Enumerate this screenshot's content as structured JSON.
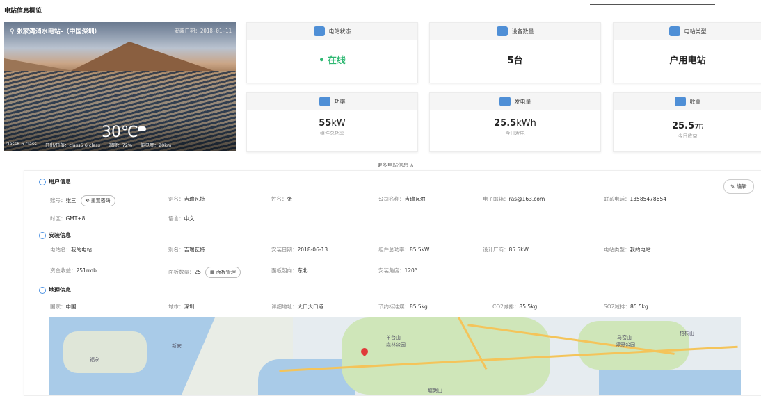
{
  "page": {
    "title": "电站信息概览"
  },
  "hero": {
    "name": "张家湾消水电站-（中国深圳）",
    "install_date": "安装日期：2018-01-11",
    "temperature": "30℃",
    "bottom_items": [
      "class8 6 class",
      "日出/日落：class5 6 class",
      "湿度：72%",
      "能见度：20km"
    ]
  },
  "cards": [
    {
      "title": "电站状态",
      "value": "在线",
      "status_dot": "•"
    },
    {
      "title": "设备数量",
      "value": "5台"
    },
    {
      "title": "电站类型",
      "value": "户用电站"
    },
    {
      "title": "功率",
      "value_num": "55",
      "value_unit": "kW",
      "sub": "组件总功率",
      "dash": "—— —"
    },
    {
      "title": "发电量",
      "value_num": "25.5",
      "value_unit": "kWh",
      "sub": "今日发电",
      "dash": "—— —"
    },
    {
      "title": "收益",
      "value_num": "25.5",
      "value_unit": "元",
      "sub": "今日收益",
      "dash": "—— —"
    }
  ],
  "more_link": "更多电站信息 ∧",
  "edit_label": "编辑",
  "user": {
    "title": "用户信息",
    "account": {
      "k": "账号：",
      "v": "张三"
    },
    "reset_password": "重置密码",
    "alias": {
      "k": "别名：",
      "v": "吉瑞瓦特"
    },
    "name": {
      "k": "姓名：",
      "v": "张三"
    },
    "company": {
      "k": "公司名称：",
      "v": "吉瑞瓦尔"
    },
    "email": {
      "k": "电子邮箱：",
      "v": "ras@163.com"
    },
    "phone": {
      "k": "联系电话：",
      "v": "13585478654"
    },
    "timezone": {
      "k": "时区：",
      "v": "GMT+8"
    },
    "language": {
      "k": "语言：",
      "v": "中文"
    }
  },
  "install": {
    "title": "安装信息",
    "station_name": {
      "k": "电站名：",
      "v": "我的电站"
    },
    "alias": {
      "k": "别名：",
      "v": "吉瑞瓦特"
    },
    "install_date": {
      "k": "安装日期：",
      "v": "2018-06-13"
    },
    "total_power": {
      "k": "组件总功率：",
      "v": "85.5kW"
    },
    "manufacturer": {
      "k": "设计厂商：",
      "v": "85.5kW"
    },
    "station_type": {
      "k": "电站类型：",
      "v": "我的电站"
    },
    "fund_income": {
      "k": "资金收益：",
      "v": "251rmb"
    },
    "panel_count": {
      "k": "面板数量：",
      "v": "25"
    },
    "panel_manage": "面板管理",
    "panel_direction": {
      "k": "面板朝向：",
      "v": "东北"
    },
    "install_angle": {
      "k": "安装角度：",
      "v": "120°"
    }
  },
  "geo": {
    "title": "地理信息",
    "country": {
      "k": "国家：",
      "v": "中国"
    },
    "city": {
      "k": "城市：",
      "v": "深圳"
    },
    "address": {
      "k": "详细地址：",
      "v": "大口大口道"
    },
    "coal_saving": {
      "k": "节约标准煤：",
      "v": "85.5kg"
    },
    "co2": {
      "k": "CO2减排：",
      "v": "85.5kg"
    },
    "so2": {
      "k": "SO2减排：",
      "v": "85.5kg"
    }
  },
  "map": {
    "labels": [
      "羊台山",
      "森林公园",
      "马峦山",
      "郊野公园",
      "梧桐山",
      "新安",
      "福永",
      "塘朗山"
    ]
  }
}
